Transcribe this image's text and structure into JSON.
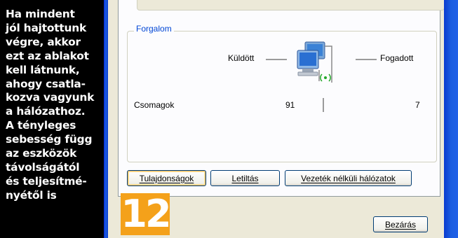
{
  "caption": {
    "text": "Ha mindent\njól hajtottunk\nvégre, akkor\nezt az ablakot\nkell látnunk,\nahogy csatla-\nkozva vagyunk\na hálózathoz.\nA tényleges\nsebesség függ\naz eszközök\ntávolságától\nés teljesítmé-\nnyétől is"
  },
  "step_badge": "12",
  "activity": {
    "group_title": "Forgalom",
    "sent_label": "Küldött",
    "received_label": "Fogadott",
    "packets_label": "Csomagok",
    "packets_sent": "91",
    "packets_received": "7"
  },
  "buttons": {
    "properties": "Tulajdonságok",
    "disable": "Letiltás",
    "wireless": "Vezeték nélküli hálózatok",
    "close": "Bezárás"
  },
  "colors": {
    "group_title": "#0046d5",
    "badge": "#f4a11a",
    "window_frame": "#1a5fd0"
  }
}
